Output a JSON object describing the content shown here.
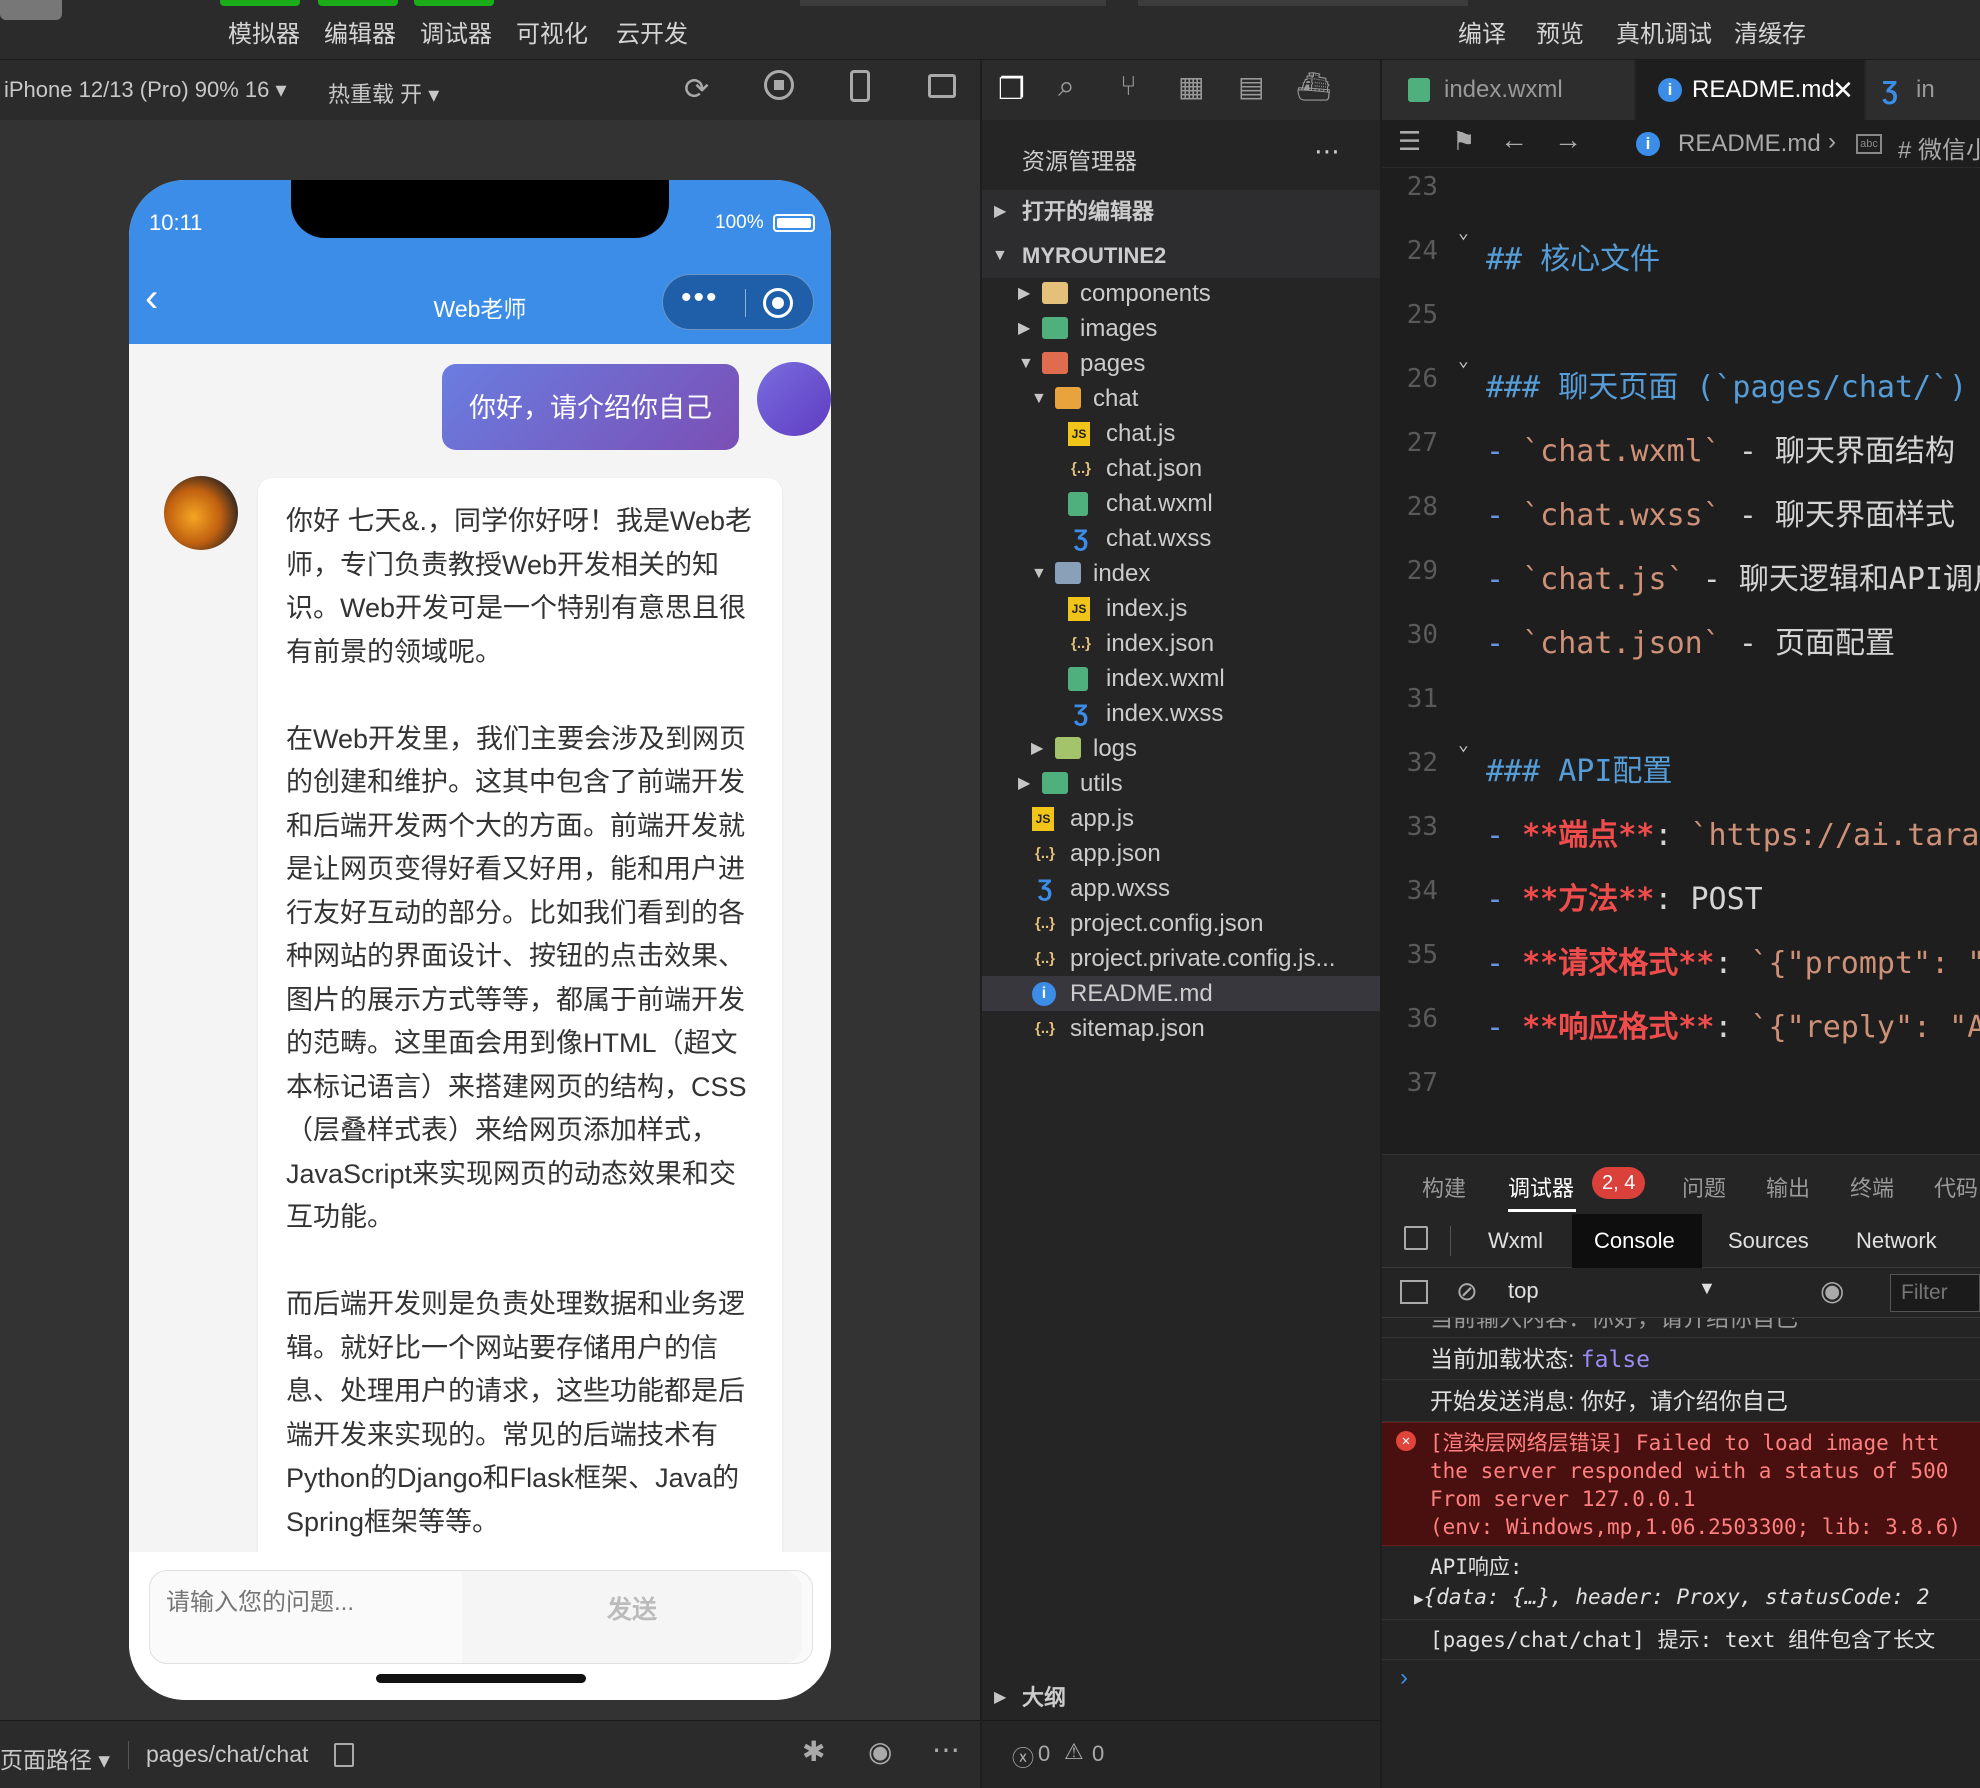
{
  "toolbar": {
    "left_tabs": [
      "模拟器",
      "编辑器",
      "调试器",
      "可视化",
      "云开发"
    ],
    "right_actions": [
      "编译",
      "预览",
      "真机调试",
      "清缓存"
    ]
  },
  "simulator": {
    "device": "iPhone 12/13 (Pro) 90% 16",
    "hot_reload": "热重载 开",
    "status_time": "10:11",
    "battery": "100%",
    "nav_title": "Web老师",
    "user_message": "你好，请介绍你自己",
    "bot_paragraphs": [
      "你好 七天&.，同学你好呀！我是Web老师，专门负责教授Web开发相关的知识。Web开发可是一个特别有意思且很有前景的领域呢。",
      "在Web开发里，我们主要会涉及到网页的创建和维护。这其中包含了前端开发和后端开发两个大的方面。前端开发就是让网页变得好看又好用，能和用户进行友好互动的部分。比如我们看到的各种网站的界面设计、按钮的点击效果、图片的展示方式等等，都属于前端开发的范畴。这里面会用到像HTML（超文本标记语言）来搭建网页的结构，CSS（层叠样式表）来给网页添加样式，JavaScript来实现网页的动态效果和交互功能。",
      "而后端开发则是负责处理数据和业务逻辑。就好比一个网站要存储用户的信息、处理用户的请求，这些功能都是后端开发来实现的。常见的后端技术有Python的Django和Flask框架、Java的Spring框架等等。"
    ],
    "input_placeholder": "请输入您的问题...",
    "send_label": "发送",
    "footer_path_label": "页面路径",
    "footer_path": "pages/chat/chat"
  },
  "explorer": {
    "title": "资源管理器",
    "open_editors": "打开的编辑器",
    "project": "MYROUTINE2",
    "outline": "大纲",
    "errors": "0",
    "warnings": "0",
    "items": [
      {
        "label": "components",
        "kind": "folder-components",
        "color": "#e5c07b"
      },
      {
        "label": "images",
        "kind": "folder-images",
        "color": "#4fb07d"
      },
      {
        "label": "pages",
        "kind": "folder-pages",
        "color": "#e06c4f"
      },
      {
        "label": "chat",
        "kind": "folder-chat",
        "color": "#e8a33d"
      },
      {
        "label": "chat.js",
        "kind": "js",
        "color": "#f0c419"
      },
      {
        "label": "chat.json",
        "kind": "json",
        "color": "#e5c07b"
      },
      {
        "label": "chat.wxml",
        "kind": "wxml",
        "color": "#4fb07d"
      },
      {
        "label": "chat.wxss",
        "kind": "wxss",
        "color": "#3b8de8"
      },
      {
        "label": "index",
        "kind": "folder-index",
        "color": "#8aa0b8"
      },
      {
        "label": "index.js",
        "kind": "js",
        "color": "#f0c419"
      },
      {
        "label": "index.json",
        "kind": "json",
        "color": "#e5c07b"
      },
      {
        "label": "index.wxml",
        "kind": "wxml",
        "color": "#4fb07d"
      },
      {
        "label": "index.wxss",
        "kind": "wxss",
        "color": "#3b8de8"
      },
      {
        "label": "logs",
        "kind": "folder-logs",
        "color": "#a3c46b"
      },
      {
        "label": "utils",
        "kind": "folder-utils",
        "color": "#4fb07d"
      },
      {
        "label": "app.js",
        "kind": "js",
        "color": "#f0c419"
      },
      {
        "label": "app.json",
        "kind": "json",
        "color": "#e5c07b"
      },
      {
        "label": "app.wxss",
        "kind": "wxss",
        "color": "#3b8de8"
      },
      {
        "label": "project.config.json",
        "kind": "json",
        "color": "#e5c07b"
      },
      {
        "label": "project.private.config.js...",
        "kind": "json",
        "color": "#e5c07b"
      },
      {
        "label": "README.md",
        "kind": "info",
        "color": "#3b8de8"
      },
      {
        "label": "sitemap.json",
        "kind": "json",
        "color": "#e5c07b"
      }
    ]
  },
  "editor": {
    "tabs": [
      "index.wxml",
      "README.md",
      "in"
    ],
    "breadcrumb_file": "README.md",
    "breadcrumb_section": "# 微信小",
    "lines": [
      {
        "n": "23",
        "parts": []
      },
      {
        "n": "24",
        "parts": [
          [
            "md-h",
            "## 核心文件"
          ]
        ]
      },
      {
        "n": "25",
        "parts": []
      },
      {
        "n": "26",
        "parts": [
          [
            "md-h",
            "### 聊天页面 (`pages/chat/`)"
          ]
        ]
      },
      {
        "n": "27",
        "parts": [
          [
            "md-dash",
            "- "
          ],
          [
            "md-code",
            "`chat.wxml`"
          ],
          [
            "md-txt",
            " - 聊天界面结构"
          ]
        ]
      },
      {
        "n": "28",
        "parts": [
          [
            "md-dash",
            "- "
          ],
          [
            "md-code",
            "`chat.wxss`"
          ],
          [
            "md-txt",
            " - 聊天界面样式"
          ]
        ]
      },
      {
        "n": "29",
        "parts": [
          [
            "md-dash",
            "- "
          ],
          [
            "md-code",
            "`chat.js`"
          ],
          [
            "md-txt",
            " - 聊天逻辑和API调用"
          ]
        ]
      },
      {
        "n": "30",
        "parts": [
          [
            "md-dash",
            "- "
          ],
          [
            "md-code",
            "`chat.json`"
          ],
          [
            "md-txt",
            " - 页面配置"
          ]
        ]
      },
      {
        "n": "31",
        "parts": []
      },
      {
        "n": "32",
        "parts": [
          [
            "md-h",
            "### API配置"
          ]
        ]
      },
      {
        "n": "33",
        "parts": [
          [
            "md-dash",
            "- "
          ],
          [
            "md-bold",
            "**端点**"
          ],
          [
            "md-txt",
            ": "
          ],
          [
            "md-code",
            "`https://ai.tarak"
          ]
        ]
      },
      {
        "n": "34",
        "parts": [
          [
            "md-dash",
            "- "
          ],
          [
            "md-bold",
            "**方法**"
          ],
          [
            "md-txt",
            ": POST"
          ]
        ]
      },
      {
        "n": "35",
        "parts": [
          [
            "md-dash",
            "- "
          ],
          [
            "md-bold",
            "**请求格式**"
          ],
          [
            "md-txt",
            ": "
          ],
          [
            "md-code",
            "`{\"prompt\": \""
          ]
        ]
      },
      {
        "n": "36",
        "parts": [
          [
            "md-dash",
            "- "
          ],
          [
            "md-bold",
            "**响应格式**"
          ],
          [
            "md-txt",
            ": "
          ],
          [
            "md-code",
            "`{\"reply\": \"A"
          ]
        ]
      },
      {
        "n": "37",
        "parts": []
      }
    ]
  },
  "devtools": {
    "top_tabs": [
      "构建",
      "调试器",
      "问题",
      "输出",
      "终端",
      "代码"
    ],
    "badge": "2, 4",
    "sub_tabs": [
      "Wxml",
      "Console",
      "Sources",
      "Network"
    ],
    "context": "top",
    "filter_placeholder": "Filter",
    "log_partial": "当前输入内容：你好，请介绍你自己",
    "log_loading_label": "当前加载状态:",
    "log_loading_value": "false",
    "log_send": "开始发送消息: 你好，请介绍你自己",
    "error_lines": [
      "[渲染层网络层错误] Failed to load image htt",
      "the server responded with a status of 500",
      "From server 127.0.0.1",
      "(env: Windows,mp,1.06.2503300; lib: 3.8.6)"
    ],
    "api_label": "API响应:",
    "api_obj": "{data: {…}, header: Proxy, statusCode: 2",
    "hint": "[pages/chat/chat]  提示:  text 组件包含了长文"
  },
  "colors": {
    "accent": "#3b8de8",
    "error_bg": "#4a0f0f",
    "badge": "#d9413a"
  }
}
